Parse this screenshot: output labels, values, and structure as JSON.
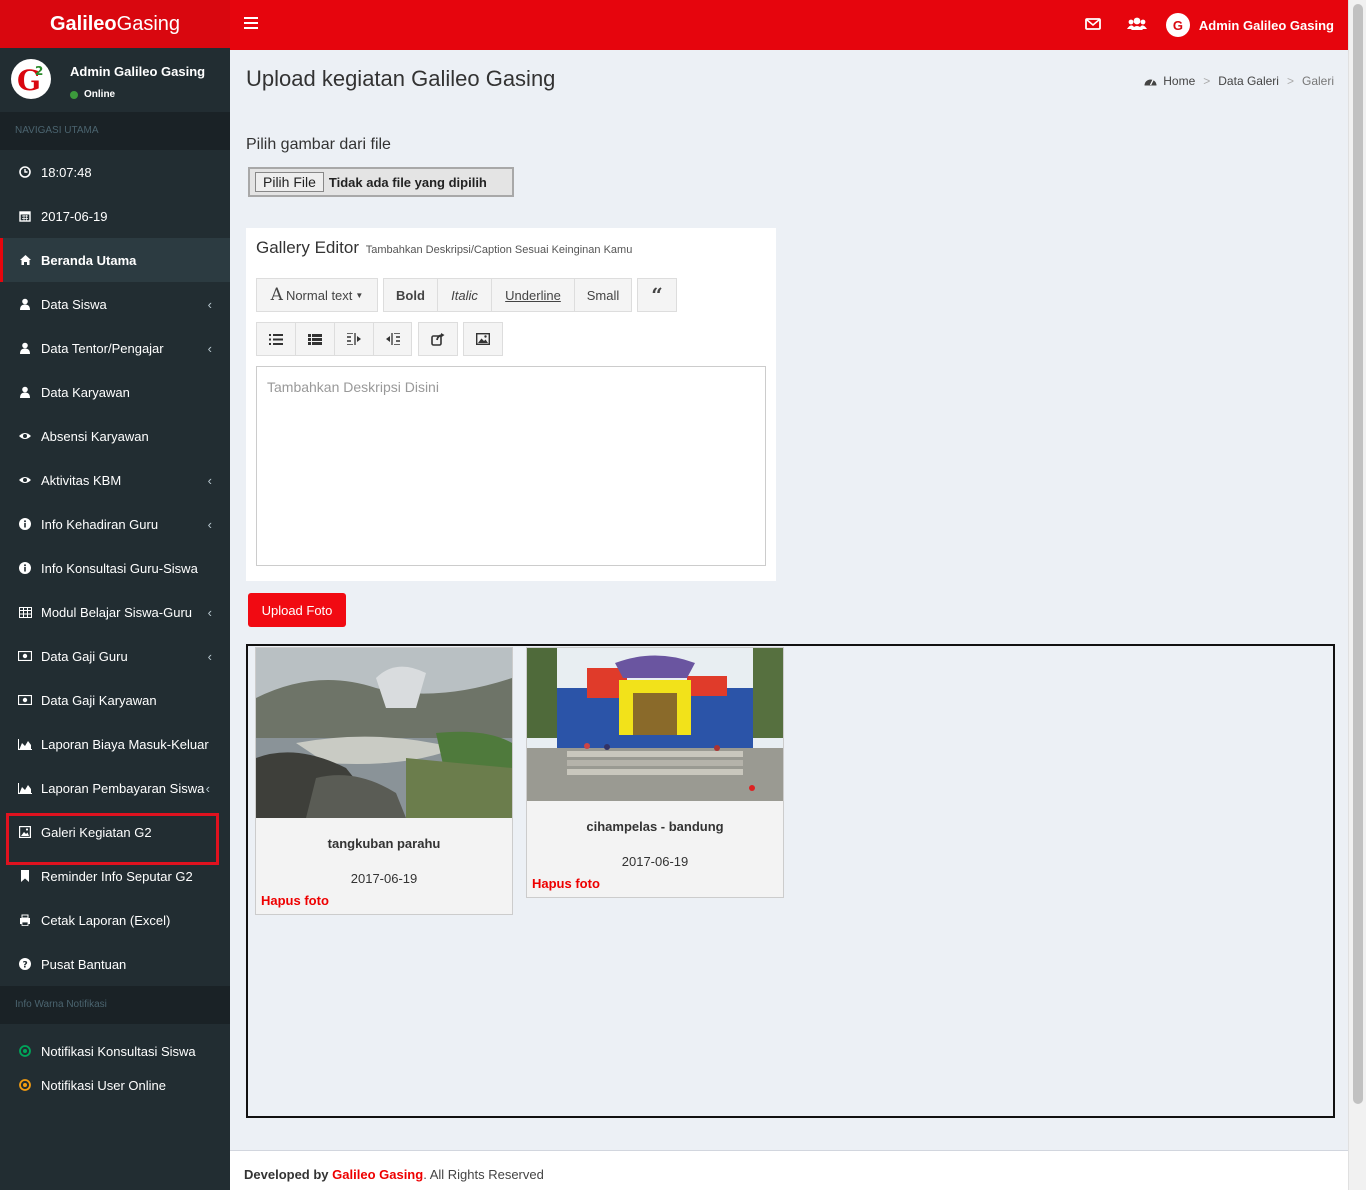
{
  "brand": {
    "bold": "Galileo",
    "light": "Gasing"
  },
  "topbar": {
    "user_name": "Admin Galileo Gasing"
  },
  "sidebar": {
    "user_name": "Admin Galileo Gasing",
    "status": "Online",
    "section_main": "NAVIGASI UTAMA",
    "time": "18:07:48",
    "date": "2017-06-19",
    "items": [
      {
        "label": "Beranda Utama"
      },
      {
        "label": "Data Siswa"
      },
      {
        "label": "Data Tentor/Pengajar"
      },
      {
        "label": "Data Karyawan"
      },
      {
        "label": "Absensi Karyawan"
      },
      {
        "label": "Aktivitas KBM"
      },
      {
        "label": "Info Kehadiran Guru"
      },
      {
        "label": "Info Konsultasi Guru-Siswa"
      },
      {
        "label": "Modul Belajar Siswa-Guru"
      },
      {
        "label": "Data Gaji Guru"
      },
      {
        "label": "Data Gaji Karyawan"
      },
      {
        "label": "Laporan Biaya Masuk-Keluar"
      },
      {
        "label": "Laporan Pembayaran Siswa"
      },
      {
        "label": "Galeri Kegiatan G2"
      },
      {
        "label": "Reminder Info Seputar G2"
      },
      {
        "label": "Cetak Laporan (Excel)"
      },
      {
        "label": "Pusat Bantuan"
      }
    ],
    "section_notif": "Info Warna Notifikasi",
    "notif_items": [
      {
        "label": "Notifikasi Konsultasi Siswa",
        "color": "#00a65a"
      },
      {
        "label": "Notifikasi User Online",
        "color": "#f39c12"
      }
    ]
  },
  "main": {
    "title": "Upload kegiatan Galileo Gasing",
    "breadcrumb": [
      "Home",
      "Data Galeri",
      "Galeri"
    ],
    "file_label": "Pilih gambar dari file",
    "file_button": "Pilih File",
    "file_status": "Tidak ada file yang dipilih",
    "editor_title": "Gallery Editor",
    "editor_subtitle": "Tambahkan Deskripsi/Caption Sesuai Keinginan Kamu",
    "toolbar": {
      "normal_text": "Normal text",
      "bold": "Bold",
      "italic": "Italic",
      "underline": "Underline",
      "small": "Small"
    },
    "editor_placeholder": "Tambahkan Deskripsi Disini",
    "upload_button": "Upload Foto",
    "photos": [
      {
        "caption": "tangkuban parahu",
        "date": "2017-06-19",
        "delete_label": "Hapus foto"
      },
      {
        "caption": "cihampelas - bandung",
        "date": "2017-06-19",
        "delete_label": "Hapus foto"
      }
    ]
  },
  "footer": {
    "prefix": "Developed by",
    "brand": "Galileo Gasing",
    "suffix": ". All Rights Reserved"
  },
  "colors": {
    "brand_red": "#e6050d",
    "sidebar_bg": "#222d32"
  }
}
